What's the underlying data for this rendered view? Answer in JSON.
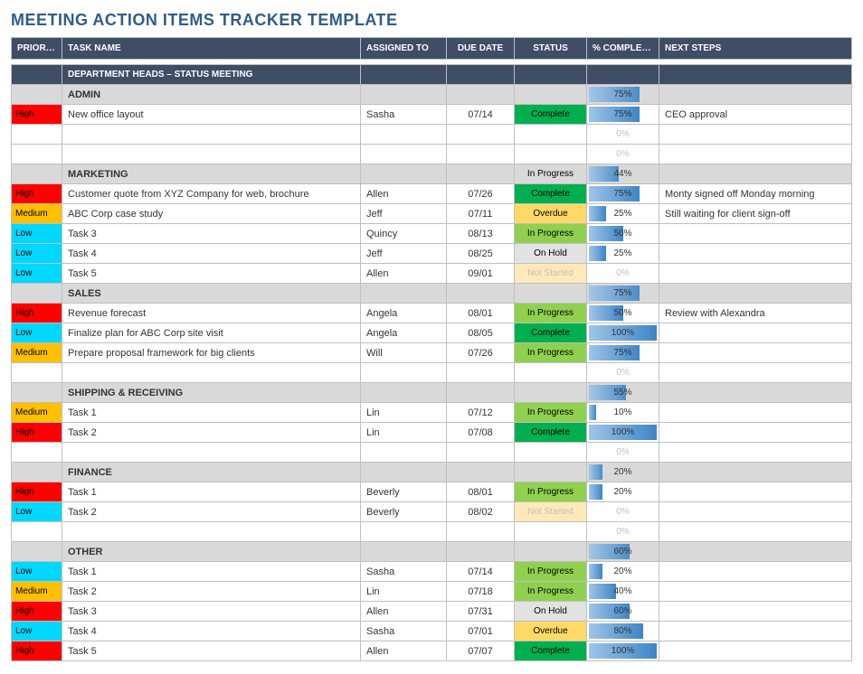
{
  "title": "MEETING ACTION ITEMS TRACKER TEMPLATE",
  "columns": {
    "priority": "PRIORITY",
    "task": "TASK NAME",
    "assigned": "ASSIGNED TO",
    "due": "DUE DATE",
    "status": "STATUS",
    "complete": "% COMPLETE",
    "next": "NEXT STEPS"
  },
  "header_row": "DEPARTMENT HEADS – STATUS MEETING",
  "status_labels": {
    "complete": "Complete",
    "inprogress": "In Progress",
    "overdue": "Overdue",
    "onhold": "On Hold",
    "notstarted": "Not Started"
  },
  "priority_labels": {
    "high": "High",
    "medium": "Medium",
    "low": "Low"
  },
  "rows": [
    {
      "type": "section",
      "task": "ADMIN",
      "complete": 75
    },
    {
      "type": "item",
      "priority": "high",
      "task": "New office layout",
      "assigned": "Sasha",
      "due": "07/14",
      "status": "complete",
      "complete": 75,
      "next": "CEO approval"
    },
    {
      "type": "item",
      "complete": 0
    },
    {
      "type": "item",
      "complete": 0
    },
    {
      "type": "section",
      "task": "MARKETING",
      "status": "inprogress",
      "complete": 44
    },
    {
      "type": "item",
      "priority": "high",
      "task": "Customer quote from XYZ Company for web, brochure",
      "assigned": "Allen",
      "due": "07/26",
      "status": "complete",
      "complete": 75,
      "next": "Monty signed off Monday morning"
    },
    {
      "type": "item",
      "priority": "medium",
      "task": "ABC Corp case study",
      "assigned": "Jeff",
      "due": "07/11",
      "status": "overdue",
      "complete": 25,
      "next": "Still waiting for client sign-off"
    },
    {
      "type": "item",
      "priority": "low",
      "task": "Task 3",
      "assigned": "Quincy",
      "due": "08/13",
      "status": "inprogress",
      "complete": 50
    },
    {
      "type": "item",
      "priority": "low",
      "task": "Task 4",
      "assigned": "Jeff",
      "due": "08/25",
      "status": "onhold",
      "complete": 25
    },
    {
      "type": "item",
      "priority": "low",
      "task": "Task 5",
      "assigned": "Allen",
      "due": "09/01",
      "status": "notstarted",
      "complete": 0
    },
    {
      "type": "section",
      "task": "SALES",
      "complete": 75
    },
    {
      "type": "item",
      "priority": "high",
      "task": "Revenue forecast",
      "assigned": "Angela",
      "due": "08/01",
      "status": "inprogress",
      "complete": 50,
      "next": "Review with Alexandra"
    },
    {
      "type": "item",
      "priority": "low",
      "task": "Finalize plan for ABC Corp site visit",
      "assigned": "Angela",
      "due": "08/05",
      "status": "complete",
      "complete": 100
    },
    {
      "type": "item",
      "priority": "medium",
      "task": "Prepare proposal framework for big clients",
      "assigned": "Will",
      "due": "07/26",
      "status": "inprogress",
      "complete": 75
    },
    {
      "type": "item",
      "complete": 0
    },
    {
      "type": "section",
      "task": "SHIPPING & RECEIVING",
      "complete": 55
    },
    {
      "type": "item",
      "priority": "medium",
      "task": "Task 1",
      "assigned": "Lin",
      "due": "07/12",
      "status": "inprogress",
      "complete": 10
    },
    {
      "type": "item",
      "priority": "high",
      "task": "Task 2",
      "assigned": "Lin",
      "due": "07/08",
      "status": "complete",
      "complete": 100
    },
    {
      "type": "item",
      "complete": 0
    },
    {
      "type": "section",
      "task": "FINANCE",
      "complete": 20
    },
    {
      "type": "item",
      "priority": "high",
      "task": "Task 1",
      "assigned": "Beverly",
      "due": "08/01",
      "status": "inprogress",
      "complete": 20
    },
    {
      "type": "item",
      "priority": "low",
      "task": "Task 2",
      "assigned": "Beverly",
      "due": "08/02",
      "status": "notstarted",
      "complete": 0
    },
    {
      "type": "item",
      "complete": 0
    },
    {
      "type": "section",
      "task": "OTHER",
      "complete": 60
    },
    {
      "type": "item",
      "priority": "low",
      "task": "Task 1",
      "assigned": "Sasha",
      "due": "07/14",
      "status": "inprogress",
      "complete": 20
    },
    {
      "type": "item",
      "priority": "medium",
      "task": "Task 2",
      "assigned": "Lin",
      "due": "07/18",
      "status": "inprogress",
      "complete": 40
    },
    {
      "type": "item",
      "priority": "high",
      "task": "Task 3",
      "assigned": "Allen",
      "due": "07/31",
      "status": "onhold",
      "complete": 60
    },
    {
      "type": "item",
      "priority": "low",
      "task": "Task 4",
      "assigned": "Sasha",
      "due": "07/01",
      "status": "overdue",
      "complete": 80
    },
    {
      "type": "item",
      "priority": "high",
      "task": "Task 5",
      "assigned": "Allen",
      "due": "07/07",
      "status": "complete",
      "complete": 100
    }
  ]
}
